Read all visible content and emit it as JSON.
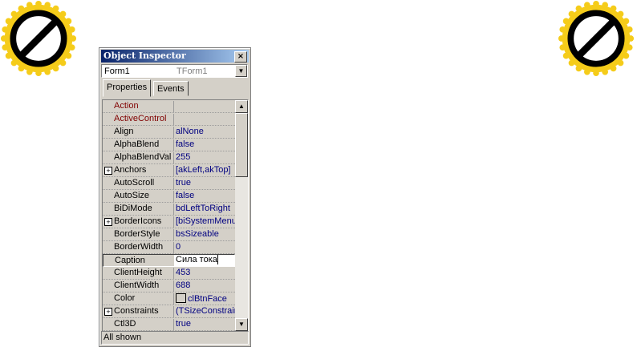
{
  "window": {
    "title": "Object Inspector",
    "object_name": "Form1",
    "object_type": "TForm1"
  },
  "tabs": [
    {
      "label": "Properties",
      "active": true
    },
    {
      "label": "Events",
      "active": false
    }
  ],
  "properties": [
    {
      "name": "Action",
      "value": "",
      "color": "#800000"
    },
    {
      "name": "ActiveControl",
      "value": "",
      "color": "#800000"
    },
    {
      "name": "Align",
      "value": "alNone"
    },
    {
      "name": "AlphaBlend",
      "value": "false"
    },
    {
      "name": "AlphaBlendValue",
      "value": "255"
    },
    {
      "name": "Anchors",
      "value": "[akLeft,akTop]",
      "expandable": true
    },
    {
      "name": "AutoScroll",
      "value": "true"
    },
    {
      "name": "AutoSize",
      "value": "false"
    },
    {
      "name": "BiDiMode",
      "value": "bdLeftToRight"
    },
    {
      "name": "BorderIcons",
      "value": "[biSystemMenu,",
      "expandable": true
    },
    {
      "name": "BorderStyle",
      "value": "bsSizeable"
    },
    {
      "name": "BorderWidth",
      "value": "0"
    },
    {
      "name": "Caption",
      "value": "Сила тока",
      "selected": true
    },
    {
      "name": "ClientHeight",
      "value": "453"
    },
    {
      "name": "ClientWidth",
      "value": "688"
    },
    {
      "name": "Color",
      "value": "clBtnFace",
      "swatch": true
    },
    {
      "name": "Constraints",
      "value": "(TSizeConstraint",
      "expandable": true
    },
    {
      "name": "Ctl3D",
      "value": "true"
    }
  ],
  "status": "All shown"
}
